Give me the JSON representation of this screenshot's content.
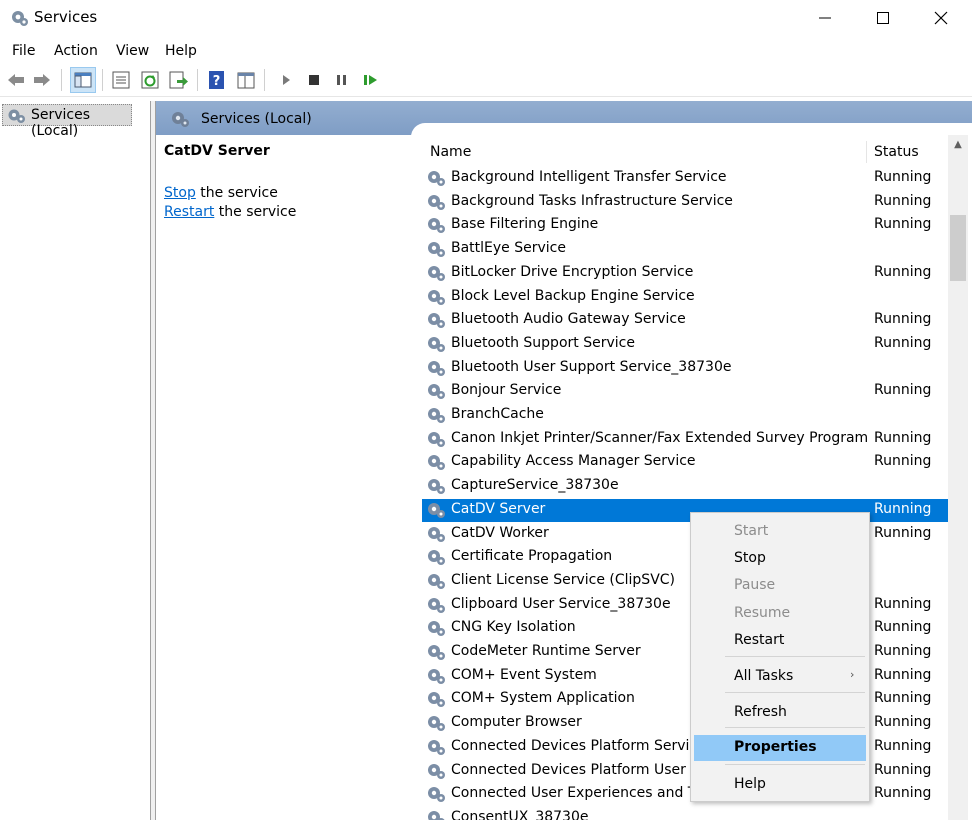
{
  "window": {
    "title": "Services"
  },
  "menubar": {
    "items": [
      "File",
      "Action",
      "View",
      "Help"
    ]
  },
  "toolbar": {
    "buttons": [
      "back-icon",
      "forward-icon",
      "show-hide-console-tree-icon",
      "properties-icon",
      "refresh-icon",
      "export-list-icon",
      "help-icon",
      "console-view-icon",
      "start-service-icon",
      "stop-service-icon",
      "pause-service-icon",
      "restart-service-icon"
    ]
  },
  "tree": {
    "root_label": "Services (Local)"
  },
  "panel": {
    "header_label": "Services (Local)",
    "selected_service": "CatDV Server",
    "action_stop_link": "Stop",
    "action_stop_rest": " the service",
    "action_restart_link": "Restart",
    "action_restart_rest": " the service"
  },
  "list": {
    "columns": {
      "name": "Name",
      "status": "Status"
    },
    "rows": [
      {
        "name": "Background Intelligent Transfer Service",
        "status": "Running"
      },
      {
        "name": "Background Tasks Infrastructure Service",
        "status": "Running"
      },
      {
        "name": "Base Filtering Engine",
        "status": "Running"
      },
      {
        "name": "BattlEye Service",
        "status": ""
      },
      {
        "name": "BitLocker Drive Encryption Service",
        "status": "Running"
      },
      {
        "name": "Block Level Backup Engine Service",
        "status": ""
      },
      {
        "name": "Bluetooth Audio Gateway Service",
        "status": "Running"
      },
      {
        "name": "Bluetooth Support Service",
        "status": "Running"
      },
      {
        "name": "Bluetooth User Support Service_38730e",
        "status": ""
      },
      {
        "name": "Bonjour Service",
        "status": "Running"
      },
      {
        "name": "BranchCache",
        "status": ""
      },
      {
        "name": "Canon Inkjet Printer/Scanner/Fax Extended Survey Program",
        "status": "Running"
      },
      {
        "name": "Capability Access Manager Service",
        "status": "Running"
      },
      {
        "name": "CaptureService_38730e",
        "status": ""
      },
      {
        "name": "CatDV Server",
        "status": "Running",
        "selected": true
      },
      {
        "name": "CatDV Worker",
        "status": "Running"
      },
      {
        "name": "Certificate Propagation",
        "status": ""
      },
      {
        "name": "Client License Service (ClipSVC)",
        "status": ""
      },
      {
        "name": "Clipboard User Service_38730e",
        "status": "Running"
      },
      {
        "name": "CNG Key Isolation",
        "status": "Running"
      },
      {
        "name": "CodeMeter Runtime Server",
        "status": "Running"
      },
      {
        "name": "COM+ Event System",
        "status": "Running"
      },
      {
        "name": "COM+ System Application",
        "status": "Running"
      },
      {
        "name": "Computer Browser",
        "status": "Running"
      },
      {
        "name": "Connected Devices Platform Service",
        "status": "Running"
      },
      {
        "name": "Connected Devices Platform User Service_38730e",
        "status": "Running"
      },
      {
        "name": "Connected User Experiences and Telemetry",
        "status": "Running"
      },
      {
        "name": "ConsentUX_38730e",
        "status": ""
      }
    ]
  },
  "context_menu": {
    "items": [
      {
        "label": "Start",
        "disabled": true
      },
      {
        "label": "Stop",
        "disabled": false
      },
      {
        "label": "Pause",
        "disabled": true
      },
      {
        "label": "Resume",
        "disabled": true
      },
      {
        "label": "Restart",
        "disabled": false
      },
      {
        "label": "All Tasks",
        "disabled": false,
        "submenu": true
      },
      {
        "label": "Refresh",
        "disabled": false
      },
      {
        "label": "Properties",
        "disabled": false,
        "highlighted": true
      },
      {
        "label": "Help",
        "disabled": false
      }
    ]
  },
  "colors": {
    "selection": "#0078d7",
    "menu_highlight": "#91c9f7",
    "header_band": "#8aa6cb",
    "link": "#0066cc"
  }
}
